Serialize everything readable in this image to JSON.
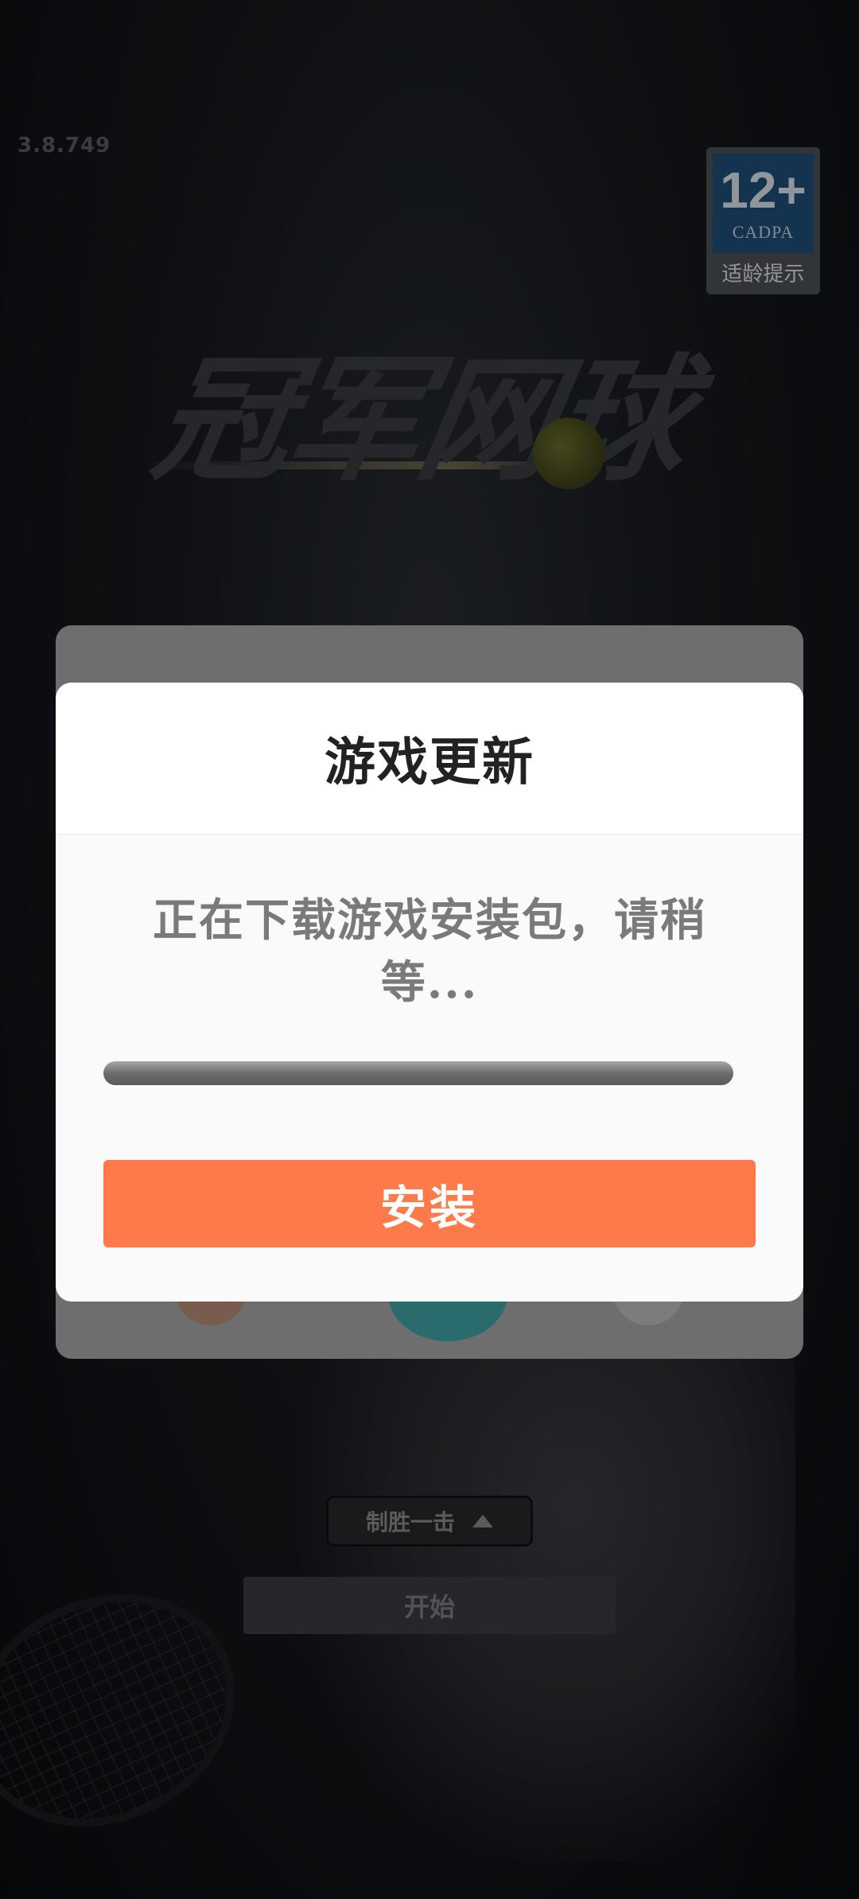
{
  "app": {
    "version": "3.8.749",
    "logo_text": "冠军网球"
  },
  "age_rating": {
    "number": "12+",
    "org": "CADPA",
    "caption": "适龄提示"
  },
  "dialog": {
    "title": "游戏更新",
    "message": "正在下载游戏安装包，请稍等...",
    "progress_percent": 100,
    "install_label": "安装"
  },
  "bottom": {
    "mode_label": "制胜一击",
    "start_label": "开始"
  },
  "colors": {
    "accent": "#ff7a4b",
    "dialog_bg": "#fafafa",
    "title_text": "#222222",
    "message_text": "#7a7a7a"
  },
  "icons": {
    "mode_chevron": "triangle-up-icon"
  }
}
